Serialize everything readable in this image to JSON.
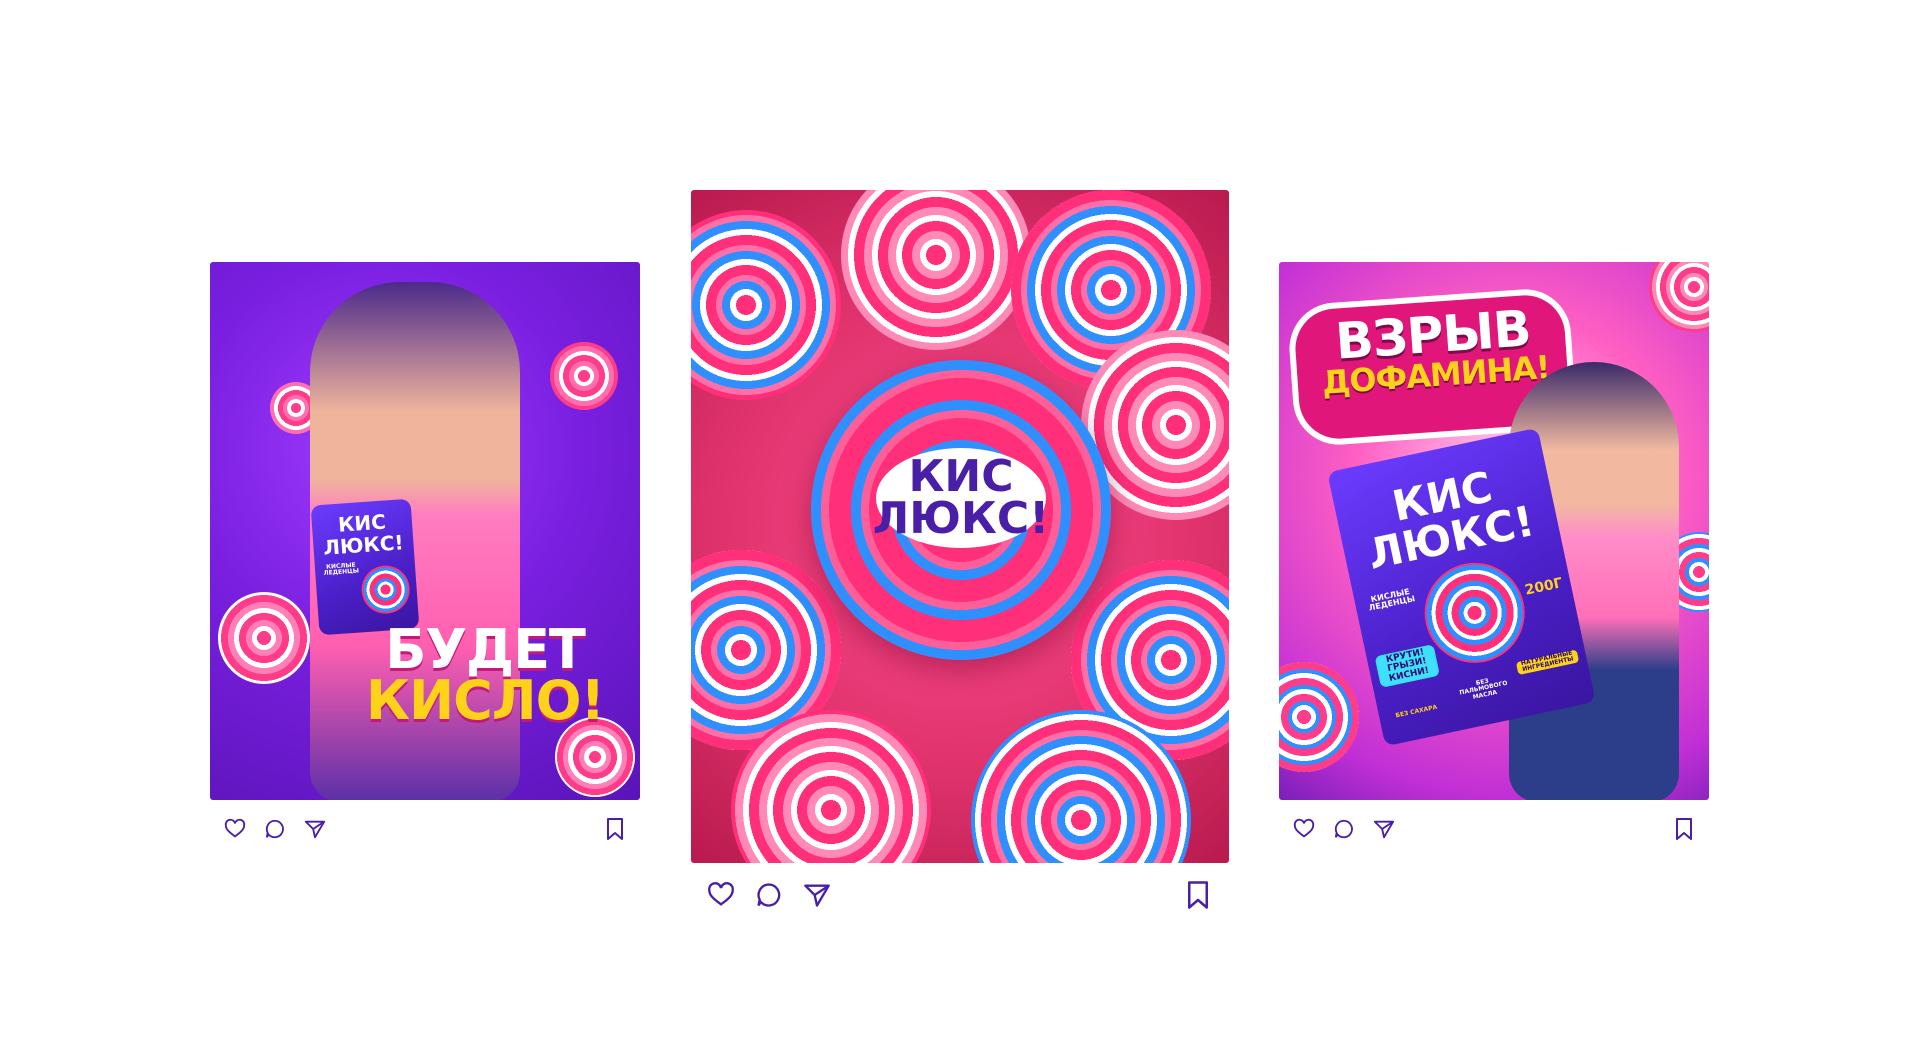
{
  "posts": [
    {
      "headline": {
        "line1": "БУДЕТ",
        "line2": "КИСЛО!"
      },
      "brand": {
        "line1": "КИС",
        "line2": "ЛЮКС!"
      },
      "pack_subtitle": "КИСЛЫЕ ЛЕДЕНЦЫ"
    },
    {
      "brand": {
        "line1": "КИС",
        "line2": "ЛЮКС!"
      }
    },
    {
      "headline": {
        "line1": "ВЗРЫВ",
        "line2": "ДОФАМИНА!"
      },
      "brand": {
        "line1": "КИС",
        "line2": "ЛЮКС!"
      },
      "pack_subtitle": "КИСЛЫЕ ЛЕДЕНЦЫ",
      "weight": "200Г",
      "badge": {
        "line1": "КРУТИ!",
        "line2": "ГРЫЗИ!",
        "line3": "КИСНИ!"
      },
      "features": [
        "БЕЗ САХАРА",
        "БЕЗ ПАЛЬМОВОГО МАСЛА",
        "НАТУРАЛЬНЫЕ ИНГРЕДИЕНТЫ"
      ]
    }
  ],
  "icons": {
    "like": "heart-icon",
    "comment": "comment-icon",
    "share": "share-icon",
    "save": "bookmark-icon"
  },
  "colors": {
    "icon_stroke": "#4a1fa8",
    "post1_bg": "#7a1fe0",
    "post2_bg": "#e0336d",
    "post3_bg": "#ff5fc2",
    "candy_pink": "#ff2f7a",
    "candy_blue": "#2f8fff",
    "accent_yellow": "#ffd21a"
  }
}
